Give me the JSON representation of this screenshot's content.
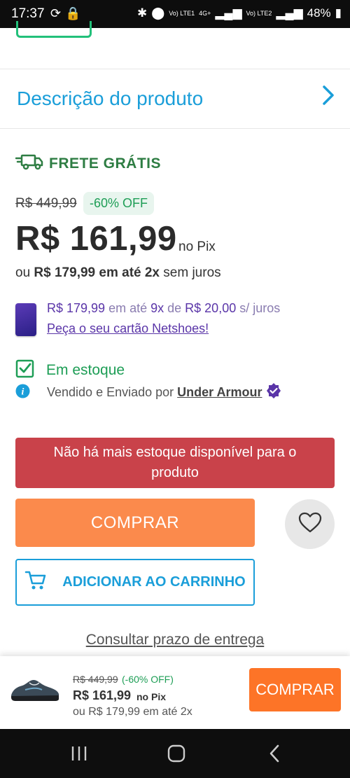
{
  "status_bar": {
    "time": "17:37",
    "battery": "48%",
    "net1": "Vo) LTE1",
    "net2": "4G+",
    "net3": "Vo) LTE2"
  },
  "description": {
    "title": "Descrição do produto"
  },
  "shipping": {
    "label": "FRETE GRÁTIS"
  },
  "price": {
    "old": "R$ 449,99",
    "discount": "-60% OFF",
    "current": "R$ 161,99",
    "pix_label": "no Pix",
    "installments_prefix": "ou ",
    "installments_bold": "R$ 179,99 em até 2x",
    "installments_suffix": " sem juros"
  },
  "card_offer": {
    "amount": "R$ 179,99",
    "text1": " em até ",
    "installments": "9x",
    "text2": " de ",
    "per_installment": "R$ 20,00",
    "text3": " s/ juros",
    "link": "Peça o seu cartão Netshoes!"
  },
  "stock": {
    "status": "Em estoque",
    "seller_prefix": "Vendido e Enviado por ",
    "seller_name": "Under Armour"
  },
  "alert": {
    "message": "Não há mais estoque disponível para o produto"
  },
  "actions": {
    "buy": "COMPRAR",
    "add_to_cart": "ADICIONAR AO CARRINHO",
    "delivery_link": "Consultar prazo de entrega"
  },
  "sticky_bar": {
    "old_price": "R$ 449,99",
    "discount": "(-60% OFF)",
    "price": "R$ 161,99",
    "pix": "no Pix",
    "installments": "ou R$ 179,99 em até 2x",
    "buy": "COMPRAR"
  },
  "colors": {
    "accent_blue": "#1a9ed9",
    "buy_orange": "#fb8a4c",
    "alert_red": "#c9424a",
    "success_green": "#1e9e56",
    "card_purple": "#5a35a8"
  },
  "icons": [
    "truck-icon",
    "chevron-right-icon",
    "check-square-icon",
    "info-icon",
    "verified-badge-icon",
    "heart-icon",
    "cart-icon",
    "shoe-thumbnail",
    "card-icon"
  ]
}
